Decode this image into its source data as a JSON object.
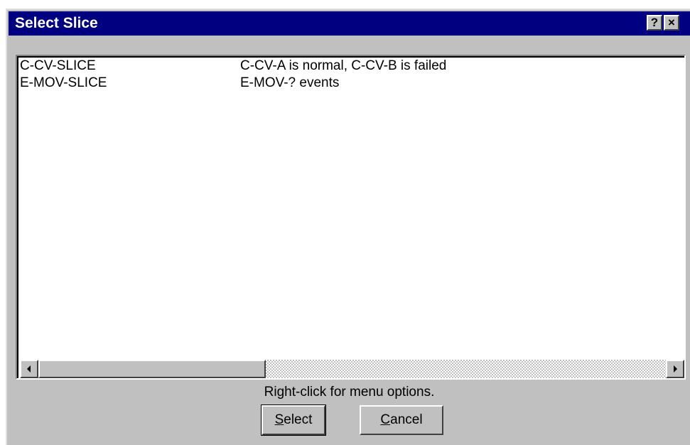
{
  "window": {
    "title": "Select Slice",
    "help_label": "?",
    "close_label": "×"
  },
  "list": {
    "rows": [
      {
        "name": "C-CV-SLICE",
        "description": "C-CV-A is normal, C-CV-B is failed"
      },
      {
        "name": "E-MOV-SLICE",
        "description": "E-MOV-? events"
      }
    ]
  },
  "hint": "Right-click for menu options.",
  "buttons": {
    "select_label": "Select",
    "select_mnemonic": "S",
    "select_rest": "elect",
    "cancel_label": "Cancel",
    "cancel_mnemonic": "C",
    "cancel_rest": "ancel"
  },
  "colors": {
    "titlebar": "#000080",
    "face": "#c0c0c0"
  }
}
